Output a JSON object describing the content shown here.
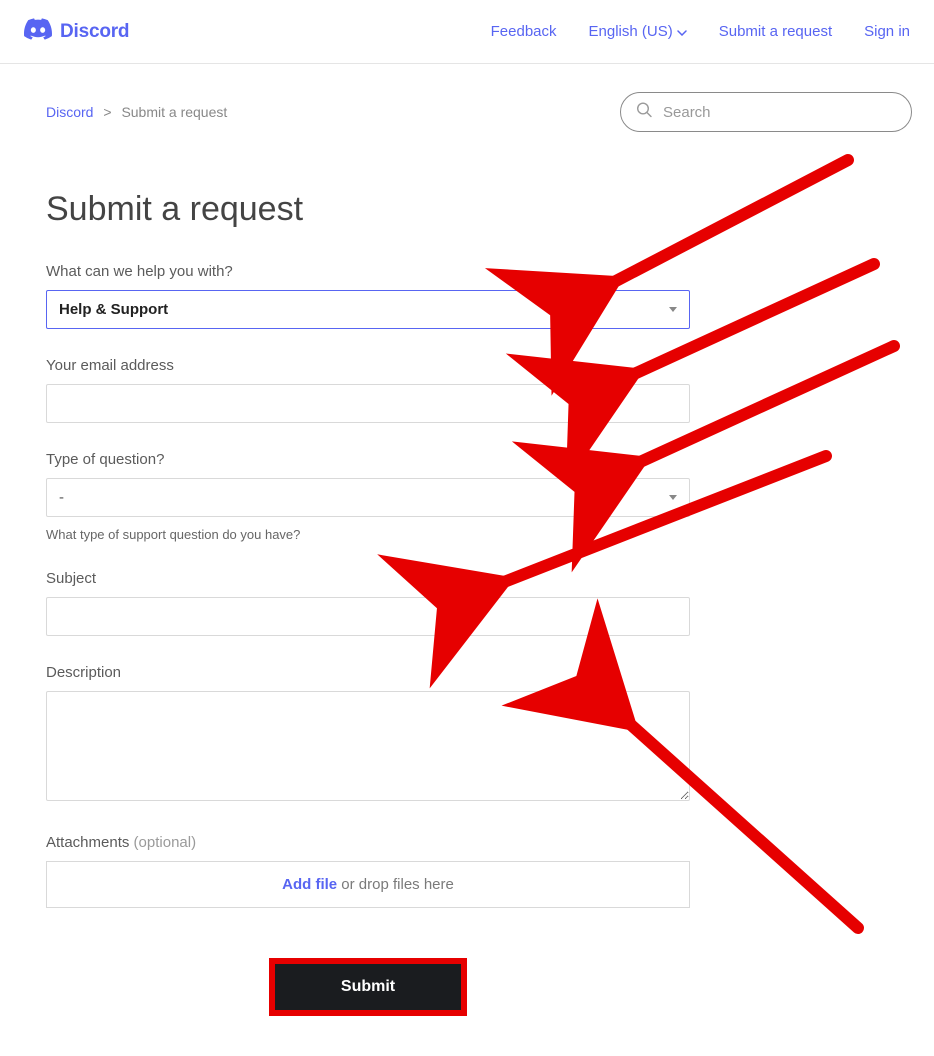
{
  "brand": {
    "name": "Discord"
  },
  "nav": {
    "feedback": "Feedback",
    "language": "English (US)",
    "submit_request": "Submit a request",
    "sign_in": "Sign in"
  },
  "breadcrumb": {
    "root": "Discord",
    "current": "Submit a request"
  },
  "search": {
    "placeholder": "Search"
  },
  "page": {
    "title": "Submit a request"
  },
  "form": {
    "help_with": {
      "label": "What can we help you with?",
      "value": "Help & Support"
    },
    "email": {
      "label": "Your email address",
      "value": ""
    },
    "question_type": {
      "label": "Type of question?",
      "value": "-",
      "hint": "What type of support question do you have?"
    },
    "subject": {
      "label": "Subject",
      "value": ""
    },
    "description": {
      "label": "Description",
      "value": ""
    },
    "attachments": {
      "label": "Attachments",
      "optional": "(optional)",
      "addfile": "Add file",
      "rest": " or drop files here"
    },
    "submit": "Submit"
  },
  "colors": {
    "accent": "#5865F2",
    "annotation": "#e60000"
  }
}
